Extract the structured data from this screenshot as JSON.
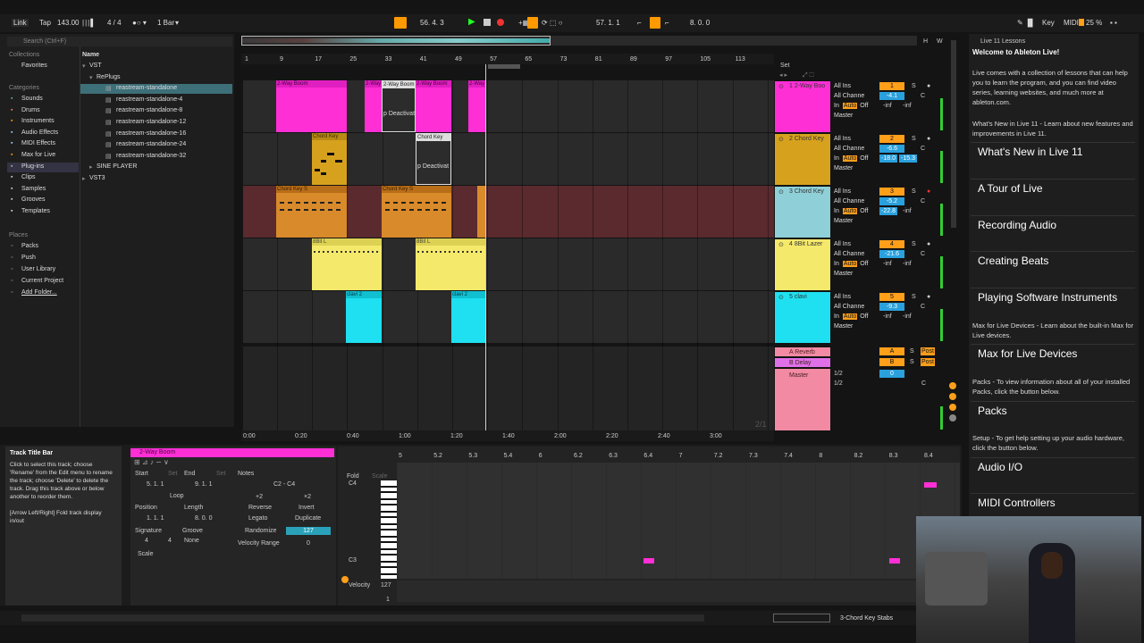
{
  "topbar": {
    "link": "Link",
    "tap": "Tap",
    "bpm": "143.00",
    "signature": "4 / 4",
    "quantize": "1 Bar",
    "position": "56.  4.  3",
    "loop_start": "57.  1.  1",
    "loop_length": "8.  0.  0",
    "key": "Key",
    "midi": "MIDI",
    "cpu": "25 %"
  },
  "browser": {
    "search_placeholder": "Search (Ctrl+F)",
    "collections_header": "Collections",
    "favorites": "Favorites",
    "categories_header": "Categories",
    "categories": [
      "Sounds",
      "Drums",
      "Instruments",
      "Audio Effects",
      "MIDI Effects",
      "Max for Live",
      "Plug-ins",
      "Clips",
      "Samples",
      "Grooves",
      "Templates"
    ],
    "places_header": "Places",
    "places": [
      "Packs",
      "Push",
      "User Library",
      "Current Project",
      "Add Folder..."
    ],
    "name_header": "Name",
    "tree": [
      "VST",
      "RePlugs",
      "reastream-standalone",
      "reastream-standalone-4",
      "reastream-standalone-8",
      "reastream-standalone-12",
      "reastream-standalone-16",
      "reastream-standalone-24",
      "reastream-standalone-32",
      "SINE PLAYER",
      "VST3"
    ]
  },
  "ruler": {
    "bars": [
      "1",
      "9",
      "17",
      "25",
      "33",
      "41",
      "49",
      "57",
      "65",
      "73",
      "81",
      "89",
      "97",
      "105",
      "113"
    ],
    "set_label": "Set"
  },
  "time_ruler": [
    "0:00",
    "0:20",
    "0:40",
    "1:00",
    "1:20",
    "1:40",
    "2:00",
    "2:20",
    "2:40",
    "3:00"
  ],
  "timecode_overlay": "2/1",
  "clips": {
    "boom": "2-Way Boom",
    "boom_deact": "p Deactivat",
    "chord": "Chord Key",
    "chord_stabs": "Chord Key S",
    "lazer": "8Bit L",
    "clavi": "clavi 2"
  },
  "tracks": [
    {
      "name": "1 2-Way Boo",
      "color": "#ff2fd6",
      "num": "1",
      "vol": "-4.1",
      "pan": "C"
    },
    {
      "name": "2 Chord Key",
      "color": "#d6a21e",
      "num": "2",
      "vol": "-6.6",
      "pan": "C",
      "send1": "-18.0",
      "send2": "-15.3"
    },
    {
      "name": "3 Chord Key",
      "color": "#8fd0d8",
      "num": "3",
      "vol": "-5.2",
      "pan": "C",
      "send1": "-22.8"
    },
    {
      "name": "4 8Bit Lazer",
      "color": "#f5e96b",
      "num": "4",
      "vol": "-21.6",
      "pan": "C"
    },
    {
      "name": "5 clavi",
      "color": "#1ee0f0",
      "num": "5",
      "vol": "-9.3",
      "pan": "C"
    }
  ],
  "io": {
    "input": "All Ins",
    "channel": "All Channe",
    "in": "In",
    "auto": "Auto",
    "off": "Off",
    "output": "Master",
    "inf": "-inf"
  },
  "returns": [
    {
      "name": "A Reverb",
      "num": "A",
      "post": "Post"
    },
    {
      "name": "B Delay",
      "num": "B",
      "post": "Post"
    }
  ],
  "master": {
    "name": "Master",
    "out1": "1/2",
    "out2": "1/2",
    "vol": "0",
    "pan": "C"
  },
  "info": {
    "title": "Track Title Bar",
    "body": "Click to select this track; choose 'Rename' from the Edit menu to rename the track; choose 'Delete' to delete the track. Drag this track above or below another to reorder them.",
    "hint": "[Arrow Left/Right] Fold track display in/out"
  },
  "clipview": {
    "name": "2-Way Boom",
    "start_label": "Start",
    "end_label": "End",
    "set": "Set",
    "start": "5.  1.  1",
    "end": "9.  1.  1",
    "loop": "Loop",
    "position_label": "Position",
    "length_label": "Length",
    "position": "1.  1.  1",
    "length": "8.  0.  0",
    "signature_label": "Signature",
    "groove_label": "Groove",
    "sig_num": "4",
    "sig_den": "4",
    "groove": "None",
    "scale": "Scale",
    "notes_label": "Notes",
    "range": "C2 - C4",
    "plus2": "+2",
    "times2": "×2",
    "reverse": "Reverse",
    "invert": "Invert",
    "legato": "Legato",
    "duplicate": "Duplicate",
    "randomize": "Randomize",
    "rand_val": "127",
    "vel_range": "Velocity Range",
    "vel_val": "0"
  },
  "editor": {
    "fold": "Fold",
    "scale": "Scale",
    "c4": "C4",
    "c3": "C3",
    "velocity": "Velocity",
    "v127": "127",
    "v1": "1",
    "ruler": [
      "5",
      "5.2",
      "5.3",
      "5.4",
      "6",
      "6.2",
      "6.3",
      "6.4",
      "7",
      "7.2",
      "7.3",
      "7.4",
      "8",
      "8.2",
      "8.3",
      "8.4"
    ]
  },
  "statusbar": {
    "track": "3-Chord Key Stabs"
  },
  "lessons": {
    "header": "Live 11 Lessons",
    "welcome": "Welcome to Ableton Live!",
    "intro": "Live comes with a collection of lessons that can help you to learn the program, and you can find video series, learning websites, and much more at ableton.com.",
    "whatsnew_text": "What's New in Live 11 - Learn about new features and improvements in Live 11.",
    "items": [
      "What's New in Live 11",
      "A Tour of Live",
      "Recording Audio",
      "Creating Beats",
      "Playing Software Instruments",
      "Max for Live Devices",
      "Packs",
      "Audio I/O",
      "MIDI Controllers"
    ],
    "m4l_text": "Max for Live Devices - Learn about the built-in Max for Live devices.",
    "packs_text": "Packs - To view information about all of your installed Packs, click the button below.",
    "setup_text": "Setup - To get help setting up your audio hardware, click the button below."
  }
}
